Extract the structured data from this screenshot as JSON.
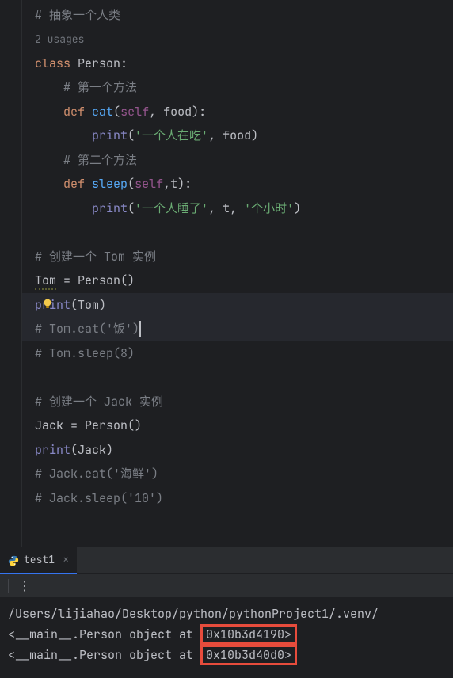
{
  "editor": {
    "lines": {
      "l1": "# 抽象一个人类",
      "usages": "2 usages",
      "l2_kw": "class",
      "l2_name": " Person",
      "l2_colon": ":",
      "l3": "# 第一个方法",
      "l4_def": "def",
      "l4_name": " eat",
      "l4_self": "self",
      "l4_param": " food",
      "l5_print": "print",
      "l5_str": "'一个人在吃'",
      "l5_p2": " food",
      "l6": "# 第二个方法",
      "l7_def": "def",
      "l7_name": " sleep",
      "l7_self": "self",
      "l7_p": "t",
      "l8_print": "print",
      "l8_s1": "'一个人睡了'",
      "l8_t": " t",
      "l8_s2": " '个小时'",
      "l10": "# 创建一个 Tom 实例",
      "l11_v": "Tom",
      "l11_eq": " = ",
      "l11_c": "Person",
      "l12_p": "print",
      "l12_a": "Tom",
      "l13": "# Tom.eat('饭')",
      "l14": "# Tom.sleep(8)",
      "l16": "# 创建一个 Jack 实例",
      "l17_v": "Jack",
      "l17_eq": " = ",
      "l17_c": "Person",
      "l18_p": "print",
      "l18_a": "Jack",
      "l19": "# Jack.eat('海鲜')",
      "l20": "# Jack.sleep('10')"
    }
  },
  "tab": {
    "name": "test1"
  },
  "console": {
    "path": "/Users/lijiahao/Desktop/python/pythonProject1/.venv/",
    "out1_pre": "<__main__.Person object at ",
    "out1_hex": "0x10b3d4190>",
    "out2_pre": "<__main__.Person object at ",
    "out2_hex": "0x10b3d40d0>"
  }
}
